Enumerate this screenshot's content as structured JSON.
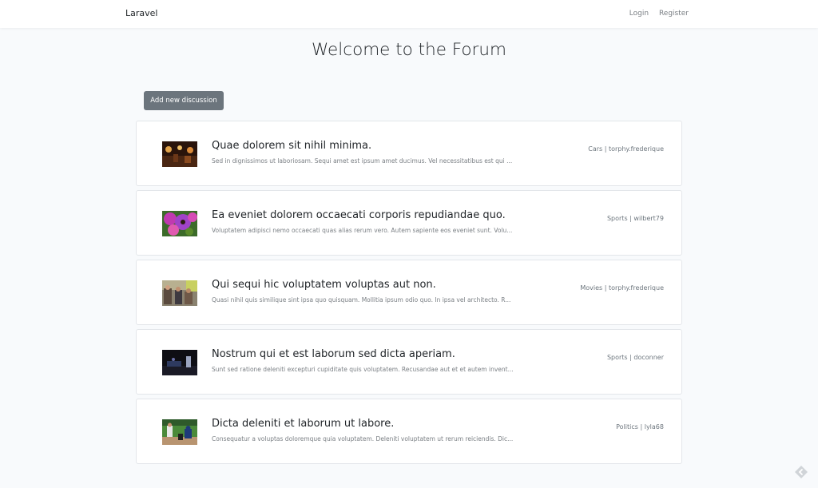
{
  "navbar": {
    "brand": "Laravel",
    "links": [
      "Login",
      "Register"
    ]
  },
  "page": {
    "title": "Welcome to the Forum",
    "add_button": "Add new discussion"
  },
  "discussions": [
    {
      "title": "Quae dolorem sit nihil minima.",
      "excerpt": "Sed in dignissimos ut laboriosam. Sequi amet est ipsum amet ducimus. Vel necessitatibus est qui ...",
      "meta": "Cars | torphy.frederique",
      "thumbnail": "photo-restaurant-night"
    },
    {
      "title": "Ea eveniet dolorem occaecati corporis repudiandae quo.",
      "excerpt": "Voluptatem adipisci nemo occaecati quas alias rerum vero. Autem sapiente eos eveniet sunt. Volu...",
      "meta": "Sports | wilbert79",
      "thumbnail": "photo-purple-flowers"
    },
    {
      "title": "Qui sequi hic voluptatem voluptas aut non.",
      "excerpt": "Quasi nihil quis similique sint ipsa quo quisquam. Mollitia ipsum odio quo. In ipsa vel architecto. R...",
      "meta": "Movies | torphy.frederique",
      "thumbnail": "photo-people-street"
    },
    {
      "title": "Nostrum qui et est laborum sed dicta aperiam.",
      "excerpt": "Sunt sed ratione deleniti excepturi cupiditate quis voluptatem. Recusandae aut et et autem invent...",
      "meta": "Sports | doconner",
      "thumbnail": "photo-dark-stage"
    },
    {
      "title": "Dicta deleniti et laborum ut labore.",
      "excerpt": "Consequatur a voluptas doloremque quia voluptatem. Deleniti voluptatem ut rerum reiciendis. Dic...",
      "meta": "Politics | lyla68",
      "thumbnail": "photo-baseball-game"
    }
  ],
  "colors": {
    "background": "#f8fafc",
    "button": "#6c757d",
    "card_border": "#e3e6ea"
  }
}
